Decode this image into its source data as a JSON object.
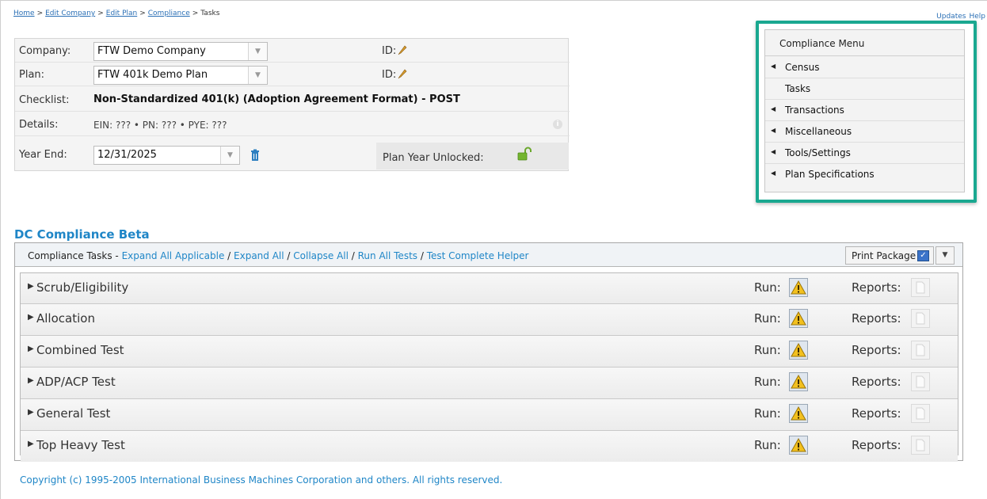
{
  "breadcrumb": {
    "items": [
      "Home",
      "Edit Company",
      "Edit Plan",
      "Compliance"
    ],
    "current": "Tasks",
    "separator": ">"
  },
  "top_links": [
    "Updates",
    "Help"
  ],
  "plan_info": {
    "company_label": "Company:",
    "company_value": "FTW Demo Company",
    "plan_label": "Plan:",
    "plan_value": "FTW 401k Demo Plan",
    "id_label": "ID:",
    "checklist_label": "Checklist:",
    "checklist_value": "Non-Standardized 401(k) (Adoption Agreement Format) - POST",
    "details_label": "Details:",
    "details_value": "EIN: ??? • PN: ??? • PYE: ???",
    "year_end_label": "Year End:",
    "year_end_value": "12/31/2025",
    "unlocked_label": "Plan Year Unlocked:"
  },
  "compliance_menu": {
    "title": "Compliance Menu",
    "items": [
      {
        "label": "Census",
        "has_arrow": true
      },
      {
        "label": "Tasks",
        "has_arrow": false
      },
      {
        "label": "Transactions",
        "has_arrow": true
      },
      {
        "label": "Miscellaneous",
        "has_arrow": true
      },
      {
        "label": "Tools/Settings",
        "has_arrow": true
      },
      {
        "label": "Plan Specifications",
        "has_arrow": true
      }
    ],
    "accent_color": "#1aa890"
  },
  "dc": {
    "title": "DC Compliance Beta",
    "header_label": "Compliance Tasks - ",
    "links": [
      "Expand All Applicable",
      "Expand All",
      "Collapse All",
      "Run All Tests",
      "Test Complete Helper"
    ],
    "print_label": "Print Package",
    "tasks": [
      {
        "name": "Scrub/Eligibility"
      },
      {
        "name": "Allocation"
      },
      {
        "name": "Combined Test"
      },
      {
        "name": "ADP/ACP Test"
      },
      {
        "name": "General Test"
      },
      {
        "name": "Top Heavy Test"
      }
    ],
    "run_label": "Run:",
    "reports_label": "Reports:"
  },
  "footer": {
    "copyright": "Copyright (c) 1995-2005 International Business Machines Corporation and others. All rights reserved."
  },
  "colors": {
    "link": "#1f86c7",
    "title": "#1f86c7",
    "warning": "#f2c01e"
  },
  "icons": [
    "pencil-icon",
    "info-icon",
    "trash-icon",
    "unlock-icon",
    "warning-icon",
    "report-icon",
    "checkbox-icon",
    "chevron-down-icon",
    "triangle-right-icon",
    "triangle-left-icon"
  ]
}
